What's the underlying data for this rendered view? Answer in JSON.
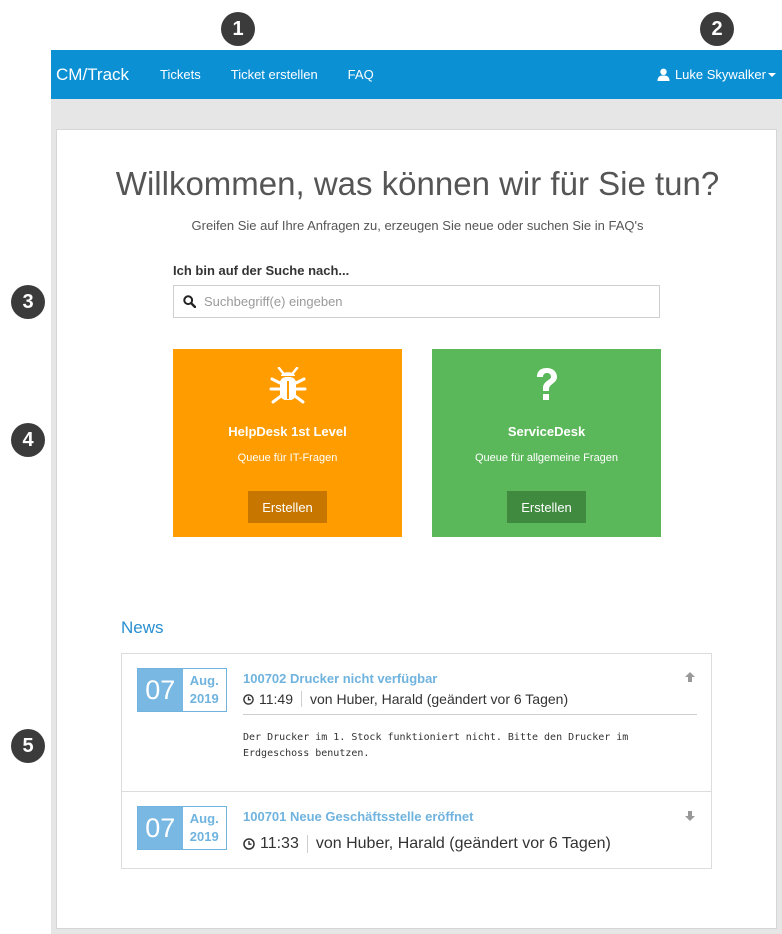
{
  "markers": [
    "1",
    "2",
    "3",
    "4",
    "5"
  ],
  "navbar": {
    "brand": "CM/Track",
    "links": [
      "Tickets",
      "Ticket erstellen",
      "FAQ"
    ],
    "user": "Luke Skywalker"
  },
  "hero": {
    "title": "Willkommen, was können wir für Sie tun?",
    "subtitle": "Greifen Sie auf Ihre Anfragen zu, erzeugen Sie neue oder suchen Sie in FAQ's"
  },
  "search": {
    "label": "Ich bin auf der Suche nach...",
    "placeholder": "Suchbegriff(e) eingeben"
  },
  "tiles": [
    {
      "icon": "bug-icon",
      "title": "HelpDesk 1st Level",
      "subtitle": "Queue für IT-Fragen",
      "button": "Erstellen",
      "color": "#fe9c00"
    },
    {
      "icon": "question-icon",
      "title": "ServiceDesk",
      "subtitle": "Queue für allgemeine Fragen",
      "button": "Erstellen",
      "color": "#5bb85a"
    }
  ],
  "news": {
    "heading": "News",
    "items": [
      {
        "day": "07",
        "month": "Aug.",
        "year": "2019",
        "title": "100702 Drucker nicht verfügbar",
        "time": "11:49",
        "author": "von Huber, Harald (geändert vor 6 Tagen)",
        "body": "Der Drucker im 1. Stock funktioniert nicht. Bitte den Drucker im Erdgeschoss benutzen.",
        "arrow": "arrow-up-icon"
      },
      {
        "day": "07",
        "month": "Aug.",
        "year": "2019",
        "title": "100701 Neue Geschäftsstelle eröffnet",
        "time": "11:33",
        "author": "von Huber, Harald (geändert vor 6 Tagen)",
        "arrow": "arrow-down-icon"
      }
    ]
  },
  "colors": {
    "navbar": "#0c90d4",
    "accent": "#2a8fd0",
    "date_block": "#78b8e3"
  }
}
